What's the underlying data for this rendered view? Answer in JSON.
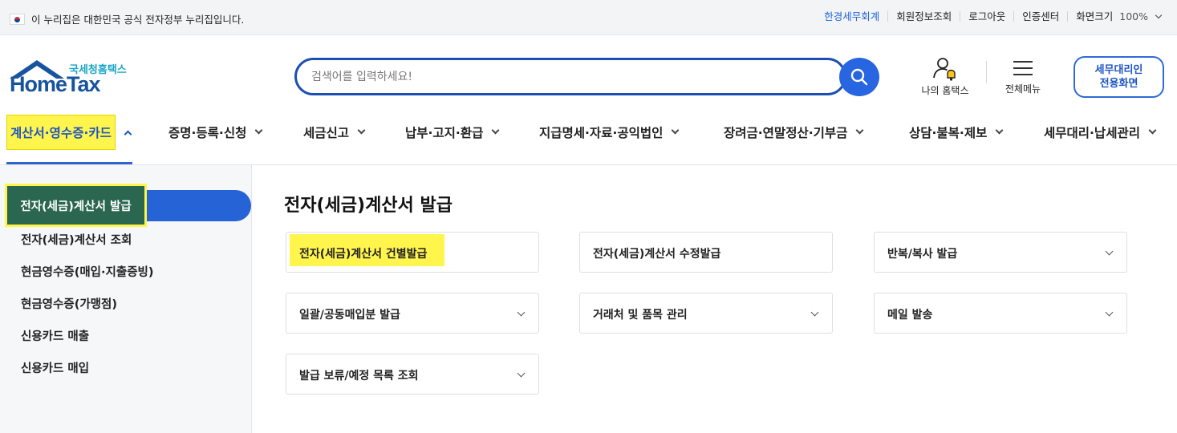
{
  "gov_banner": {
    "text": "이 누리집은 대한민국 공식 전자정부 누리집입니다.",
    "links": [
      "한경세무회계",
      "회원정보조회",
      "로그아웃",
      "인증센터"
    ],
    "screen_size_label": "화면크기",
    "zoom": "100%"
  },
  "logo": {
    "sub": "국세청홈택스",
    "main": "HomeTax"
  },
  "search": {
    "placeholder": "검색어를 입력하세요!"
  },
  "header": {
    "my_hometax": "나의 홈택스",
    "all_menu": "전체메뉴",
    "agent_line1": "세무대리인",
    "agent_line2": "전용화면"
  },
  "gnb": [
    "계산서·영수증·카드",
    "증명·등록·신청",
    "세금신고",
    "납부·고지·환급",
    "지급명세·자료·공익법인",
    "장려금·연말정산·기부금",
    "상담·불복·제보",
    "세무대리·납세관리"
  ],
  "sidebar": {
    "active": "전자(세금)계산서 발급",
    "items": [
      "전자(세금)계산서 조회",
      "현금영수증(매입·지출증빙)",
      "현금영수증(가맹점)",
      "신용카드 매출",
      "신용카드 매입"
    ]
  },
  "main": {
    "title": "전자(세금)계산서 발급",
    "cards": [
      "전자(세금)계산서 건별발급",
      "전자(세금)계산서 수정발급",
      "반복/복사 발급",
      "일괄/공동매입분 발급",
      "거래처 및 품목 관리",
      "메일 발송",
      "발급 보류/예정 목록 조회"
    ]
  },
  "colors": {
    "brand_blue": "#2865e0",
    "highlight_yellow": "#fff54d",
    "active_green": "#2b6651"
  }
}
